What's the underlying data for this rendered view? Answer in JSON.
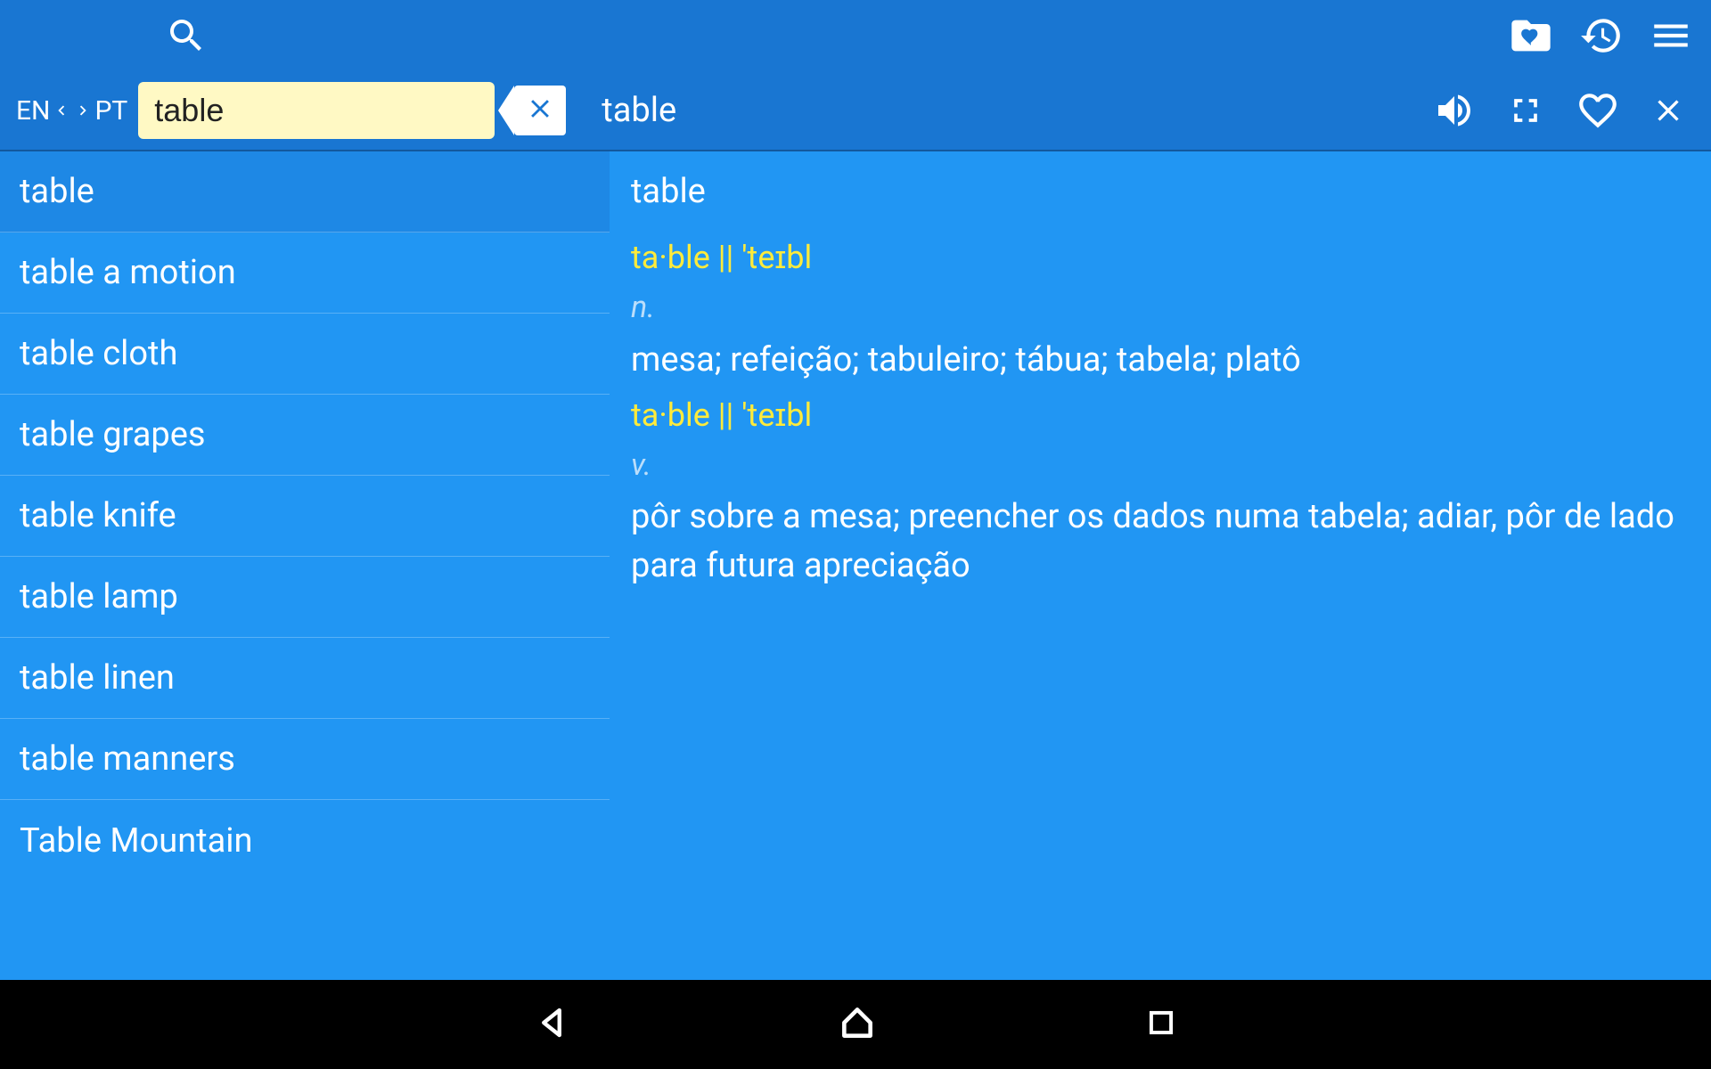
{
  "toolbar": {
    "lang_from": "EN",
    "lang_to": "PT",
    "search_value": "table",
    "headword": "table"
  },
  "sidebar": {
    "items": [
      {
        "label": "table",
        "selected": true
      },
      {
        "label": "table a motion",
        "selected": false
      },
      {
        "label": "table cloth",
        "selected": false
      },
      {
        "label": "table grapes",
        "selected": false
      },
      {
        "label": "table knife",
        "selected": false
      },
      {
        "label": "table lamp",
        "selected": false
      },
      {
        "label": "table linen",
        "selected": false
      },
      {
        "label": "table manners",
        "selected": false
      },
      {
        "label": "Table Mountain",
        "selected": false
      }
    ]
  },
  "detail": {
    "headword": "table",
    "senses": [
      {
        "phon": "ta·ble || 'teɪbl",
        "pos": "n.",
        "def": "mesa; refeição; tabuleiro; tábua; tabela; platô"
      },
      {
        "phon": "ta·ble || 'teɪbl",
        "pos": "v.",
        "def": "pôr sobre a mesa; preencher os dados numa tabela; adiar, pôr de lado para futura apreciação"
      }
    ]
  }
}
